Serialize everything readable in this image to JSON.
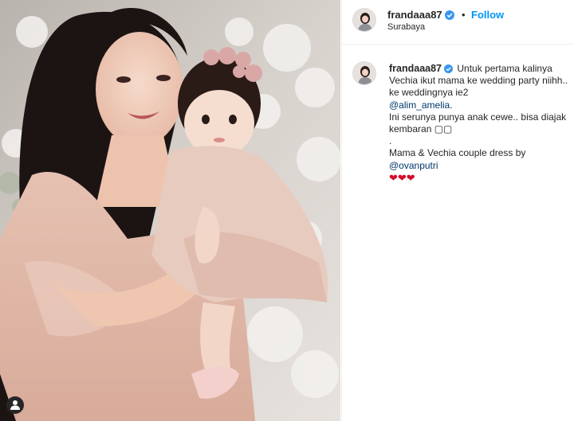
{
  "post": {
    "photo_alt": "Mother and baby in pink dresses",
    "user_tag_icon": "person-icon"
  },
  "header": {
    "username": "frandaaa87",
    "separator": "•",
    "follow_label": "Follow",
    "location": "Surabaya"
  },
  "caption": {
    "username": "frandaaa87",
    "line1": "Untuk pertama kalinya Vechia ikut mama ke wedding party niihh.. ke weddingnya ie2",
    "mention1": "@alim_amelia",
    "line2_end": ".",
    "line3": "Ini serunya punya anak cewe.. bisa diajak kembaran",
    "line3_emoji": "▢▢",
    "line4": ".",
    "line5": "Mama & Vechia couple dress by",
    "mention2": "@ovanputri",
    "hearts": "❤❤❤"
  },
  "colors": {
    "link": "#00376b",
    "follow": "#0095f6",
    "verified": "#3897f0"
  }
}
